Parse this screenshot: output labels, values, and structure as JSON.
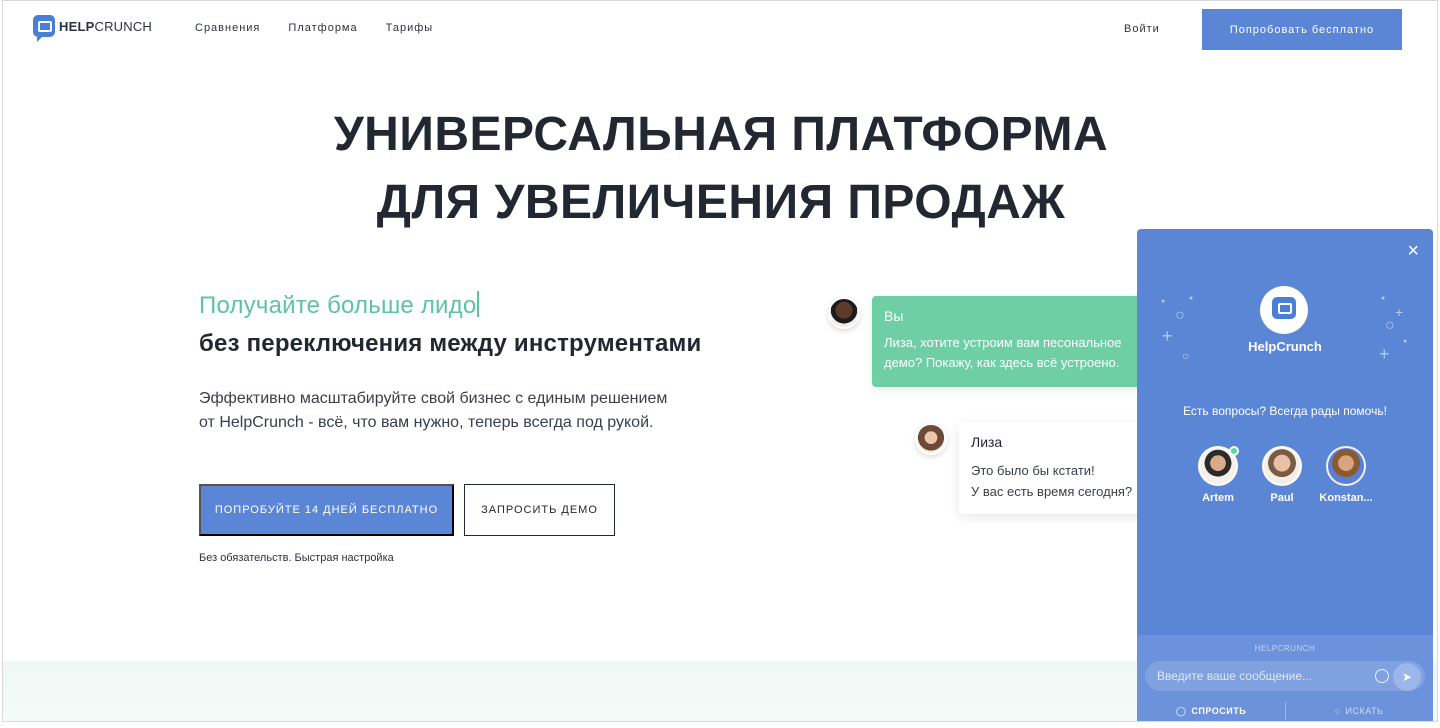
{
  "header": {
    "logo_bold": "HELP",
    "logo_light": "CRUNCH",
    "nav": [
      "Сравнения",
      "Платформа",
      "Тарифы"
    ],
    "login": "Войти",
    "try_button": "Попробовать бесплатно"
  },
  "hero": {
    "title_line1": "УНИВЕРСАЛЬНАЯ ПЛАТФОРМА",
    "title_line2": "ДЛЯ УВЕЛИЧЕНИЯ ПРОДАЖ",
    "typed_text": "Получайте больше лидо",
    "subtitle": "без переключения между инструментами",
    "description_line1": "Эффективно масштабируйте свой бизнес с единым решением",
    "description_line2": "от HelpCrunch - всё, что вам нужно, теперь всегда под рукой.",
    "cta_primary": "ПОПРОБУЙТЕ 14 ДНЕЙ БЕСПЛАТНО",
    "cta_secondary": "ЗАПРОСИТЬ ДЕМО",
    "note": "Без обязательств. Быстрая настройка"
  },
  "illustration": {
    "you_name": "Вы",
    "you_message": "Лиза, хотите устроим вам песональное демо? Покажу, как здесь всё устроено.",
    "liza_name": "Лиза",
    "liza_line1": "Это было бы кстати!",
    "liza_line2": "У вас есть время сегодня?"
  },
  "widget": {
    "close": "×",
    "brand": "HelpCrunch",
    "hint": "Есть вопросы? Всегда рады помочь!",
    "agents": [
      "Artem",
      "Paul",
      "Konstan..."
    ],
    "powered": "HELPCRUNCH",
    "input_placeholder": "Введите ваше сообщение...",
    "tab_ask": "СПРОСИТЬ",
    "tab_search": "ИСКАТЬ"
  },
  "colors": {
    "accent_blue": "#5b86d6",
    "accent_green": "#6ecfa5",
    "text_dark": "#222831"
  }
}
